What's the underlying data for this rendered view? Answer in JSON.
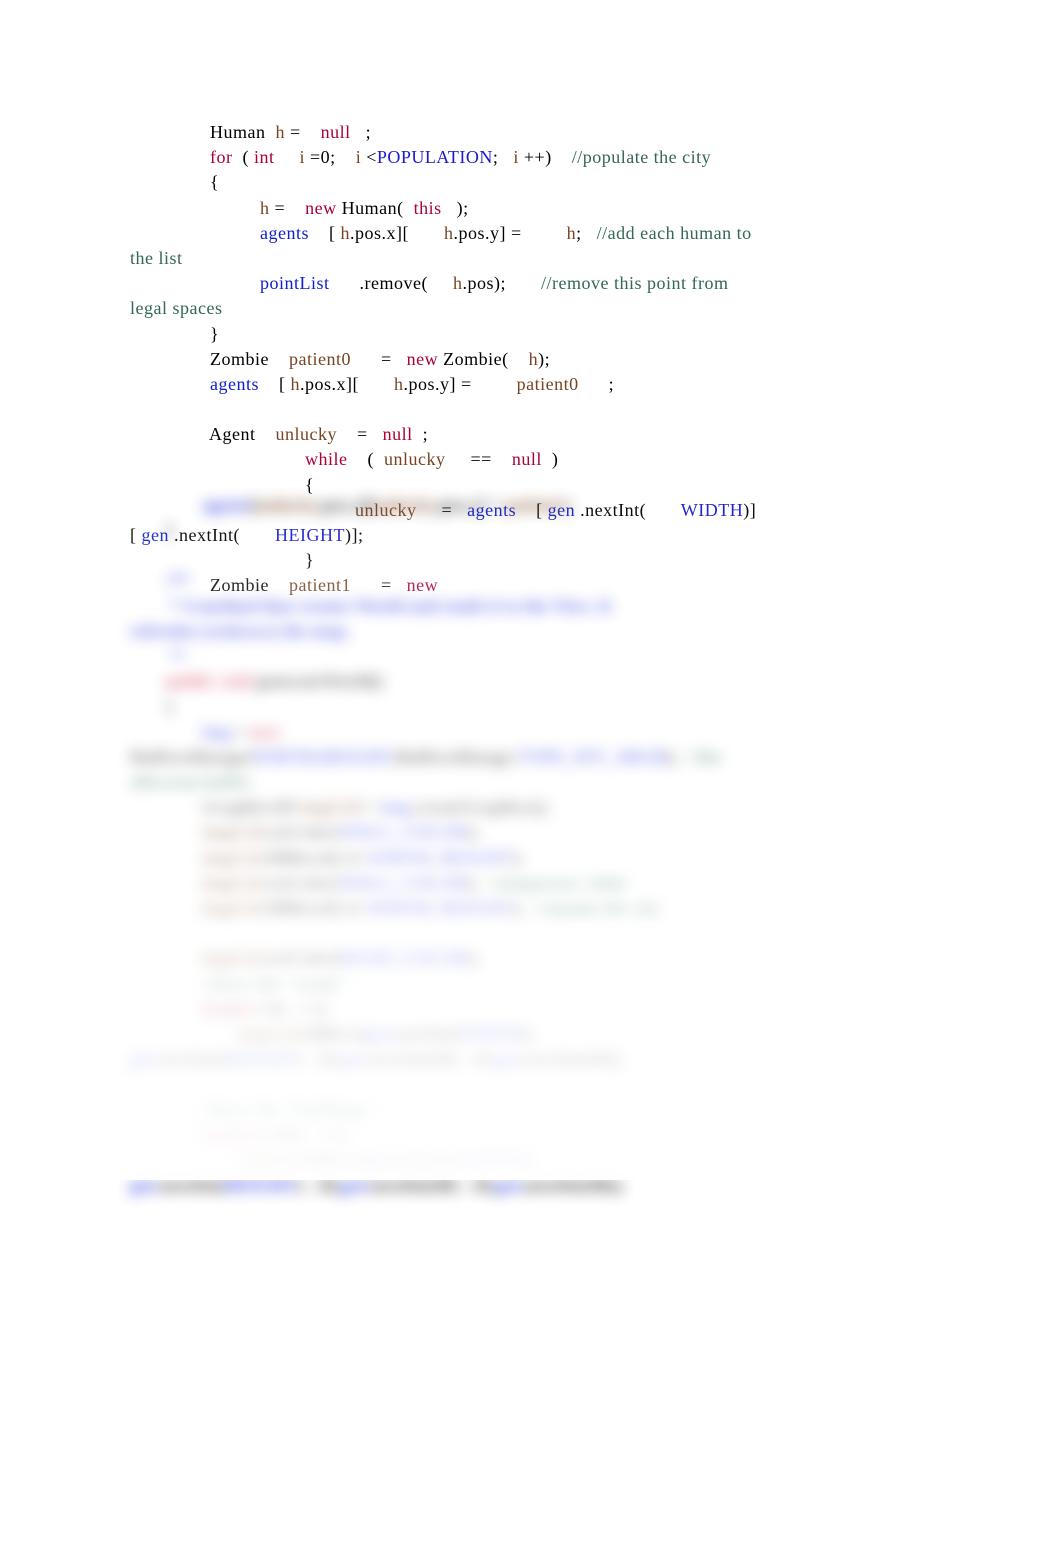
{
  "code": {
    "l1": {
      "t1": "                Human  ",
      "t2": "h",
      "t3": " =    ",
      "t4": "null",
      "t5": "   ;"
    },
    "l2": {
      "t1": "                ",
      "t2": "for",
      "t3": "  ( ",
      "t4": "int",
      "t5": "     ",
      "t6": "i",
      "t7": " =0;    ",
      "t8": "i",
      "t9": " <",
      "t10": "POPULATION",
      "t11": ";   ",
      "t12": "i",
      "t13": " ++)    ",
      "t14": "//populate the city"
    },
    "l3": {
      "t1": "                {"
    },
    "l4": {
      "t1": "                          ",
      "t2": "h",
      "t3": " =    ",
      "t4": "new",
      "t5": " Human(  ",
      "t6": "this",
      "t7": "   );"
    },
    "l5": {
      "t1": "                          ",
      "t2": "agents",
      "t3": "    [ ",
      "t4": "h",
      "t5": ".pos.x][       ",
      "t6": "h",
      "t7": ".pos.y] =         ",
      "t8": "h",
      "t9": ";   ",
      "t10": "//add each human to"
    },
    "l5b": {
      "t1": "the list"
    },
    "l6": {
      "t1": "                          ",
      "t2": "pointList",
      "t3": "      .remove(     ",
      "t4": "h",
      "t5": ".pos);       ",
      "t6": "//remove this point from"
    },
    "l6b": {
      "t1": "legal spaces"
    },
    "l7": {
      "t1": "                }"
    },
    "l8": {
      "t1": "                Zombie    ",
      "t2": "patient0",
      "t3": "      =   ",
      "t4": "new",
      "t5": " Zombie(    ",
      "t6": "h",
      "t7": ");"
    },
    "l9": {
      "t1": "                ",
      "t2": "agents",
      "t3": "    [ ",
      "t4": "h",
      "t5": ".pos.x][       ",
      "t6": "h",
      "t7": ".pos.y] =         ",
      "t8": "patient0",
      "t9": "      ;"
    },
    "l10": {
      "t1": " "
    },
    "l11": {
      "t1": "                Agent    ",
      "t2": "unlucky",
      "t3": "    =   ",
      "t4": "null",
      "t5": "  ;"
    },
    "l12": {
      "t1": "                                   ",
      "t2": "while",
      "t3": "    (  ",
      "t4": "unlucky",
      "t5": "     ==    ",
      "t6": "null",
      "t7": "  )"
    },
    "l13": {
      "t1": "                                   {"
    },
    "l14": {
      "t1": "                                             ",
      "t2": "unlucky",
      "t3": "     =   ",
      "t4": "agents",
      "t5": "    [ ",
      "t6": "gen",
      "t7": " .nextInt(       ",
      "t8": "WIDTH",
      "t9": ")]"
    },
    "l14b": {
      "t1": "[ ",
      "t2": "gen",
      "t3": " .nextInt(       ",
      "t4": "HEIGHT",
      "t5": ")];"
    },
    "l15": {
      "t1": "                                   }"
    },
    "l16": {
      "t1": "                Zombie    ",
      "t2": "patient1",
      "t3": "      =   ",
      "t4": "new",
      "t5": "  "
    }
  },
  "blurred": {
    "b1": {
      "t1": "                ",
      "t2": "agents",
      "t3": "[",
      "t4": "unlucky",
      "t5": ".pos.x][",
      "t6": "unlucky",
      "t7": ".pos.y] = ",
      "t8": "patient1",
      "t9": ";"
    },
    "b2": {
      "t1": "        }"
    },
    "b3": {
      "t1": " "
    },
    "b4": {
      "t1": "        ",
      "t2": "/**"
    },
    "b5": {
      "t1": "         ",
      "t2": "* A method that creates World and sends it to the View. It"
    },
    "b6": {
      "t1": "refreshes (redraws) the map."
    },
    "b7": {
      "t1": "         ",
      "t2": "*/"
    },
    "b8": {
      "t1": "        ",
      "t2": "public void ",
      "t3": "generateWorld()"
    },
    "b9": {
      "t1": "        {"
    },
    "b10": {
      "t1": "                ",
      "t2": "img",
      "t3": " = ",
      "t4": "new"
    },
    "b11": {
      "t1": "BufferedImage(",
      "t2": "WIDTH,HEIGHT",
      "t3": ",BufferedImage.",
      "t4": "TYPE_INT_ARGB",
      "t5": ");  ",
      "t6": "//the"
    },
    "b11c": {
      "t1": "offscreen buffer"
    },
    "b12": {
      "t1": "                Graphics2D ",
      "t2": "imgG2d",
      "t3": " = ",
      "t4": "img",
      "t5": ".createGraphics();"
    },
    "b13": {
      "t1": "                ",
      "t2": "imgG2d",
      "t3": ".setColor(",
      "t4": "WALL_COLOR",
      "t5": ");"
    },
    "b14": {
      "t1": "                ",
      "t2": "imgG2d",
      "t3": ".fillRect(0, 0, ",
      "t4": "WIDTH",
      "t5": ", ",
      "t6": "HEIGHT",
      "t7": ");"
    },
    "b15": {
      "t1": "                ",
      "t2": "imgG2d",
      "t3": ".setColor(",
      "t4": "WALL_COLOR",
      "t5": ");  ",
      "t6": "//temporary white"
    },
    "b16": {
      "t1": "                ",
      "t2": "imgG2d",
      "t3": ".fillRect(0, 0, ",
      "t4": "WIDTH",
      "t5": ", ",
      "t6": "HEIGHT",
      "t7": ");  ",
      "t8": "//repaint the city"
    },
    "b17": {
      "t1": " "
    },
    "b18": {
      "t1": "                ",
      "t2": "imgG2d",
      "t3": ".setColor(",
      "t4": "ROAD_COLOR",
      "t5": ");"
    },
    "b19": {
      "t1": "                ",
      "t2": "//draw the \"roads\""
    },
    "b20": {
      "t1": "                ",
      "t2": "for",
      "t3": "(",
      "t4": "int ",
      "t5": "i",
      "t6": "=0;  ++",
      "t7": "i",
      "t8": ")"
    },
    "b21": {
      "t1": "                        ",
      "t2": "imgG2d",
      "t3": ".fillRect(",
      "t4": "gen",
      "t5": ".nextInt(",
      "t6": "WIDTH",
      "t7": "),"
    },
    "b22": {
      "t1": "gen",
      "t2": ".nextInt(",
      "t3": "HEIGHT",
      "t4": ") - 20,",
      "t5": "gen",
      "t6": ".nextInt(40) - 20,",
      "t7": "gen",
      "t8": ".nextInt(40));"
    },
    "b23": {
      "t1": " "
    },
    "b24": {
      "t1": "                ",
      "t2": "//draw the \"buildings\""
    },
    "b25": {
      "t1": "                ",
      "t2": "for",
      "t3": "(",
      "t4": "int ",
      "t5": "i",
      "t6": "=100;  ++",
      "t7": "i",
      "t8": ")"
    },
    "b26": {
      "t1": "                        ",
      "t2": "imgG2d",
      "t3": ".fillRect(",
      "t4": "gen",
      "t5": ".nextInt(",
      "t6": "WIDTH",
      "t7": "),"
    },
    "b27": {
      "t1": "gen",
      "t2": ".nextInt(",
      "t3": "HEIGHT",
      "t4": ") - 20,",
      "t5": "gen",
      "t6": ".nextInt(40) - 20,",
      "t7": "gen",
      "t8": ".nextInt(40));"
    }
  }
}
